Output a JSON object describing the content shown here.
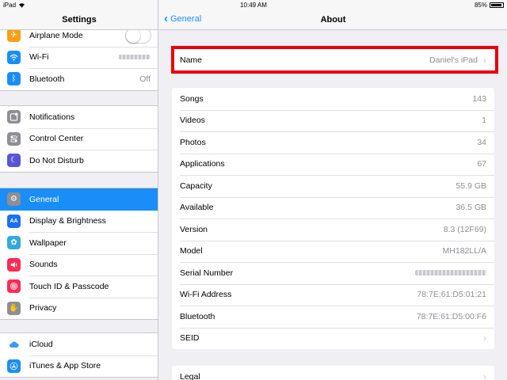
{
  "status_bar": {
    "device": "iPad",
    "time": "10:49 AM",
    "battery": "85%",
    "battery_level": 0.85
  },
  "master": {
    "title": "Settings",
    "groups": [
      [
        {
          "label": "Airplane Mode",
          "icon": "airplane-icon",
          "color": "#f7a113"
        },
        {
          "label": "Wi-Fi",
          "icon": "wifi-icon",
          "color": "#1a8ef8"
        },
        {
          "label": "Bluetooth",
          "icon": "bluetooth-icon",
          "color": "#1a8ef8",
          "value": "Off"
        }
      ],
      [
        {
          "label": "Notifications",
          "icon": "notifications-icon",
          "color": "#8e8e93"
        },
        {
          "label": "Control Center",
          "icon": "control-center-icon",
          "color": "#8e8e93"
        },
        {
          "label": "Do Not Disturb",
          "icon": "moon-icon",
          "color": "#5856d6"
        }
      ],
      [
        {
          "label": "General",
          "icon": "gear-icon",
          "color": "#8e8e93"
        },
        {
          "label": "Display & Brightness",
          "icon": "display-icon",
          "color": "#1a6ff5"
        },
        {
          "label": "Wallpaper",
          "icon": "wallpaper-icon",
          "color": "#34aadc"
        },
        {
          "label": "Sounds",
          "icon": "speaker-icon",
          "color": "#fe2c55"
        },
        {
          "label": "Touch ID & Passcode",
          "icon": "fingerprint-icon",
          "color": "#fe2c55"
        },
        {
          "label": "Privacy",
          "icon": "hand-icon",
          "color": "#8e8e93"
        }
      ],
      [
        {
          "label": "iCloud",
          "icon": "cloud-icon",
          "color": "#ffffff"
        },
        {
          "label": "iTunes & App Store",
          "icon": "app-store-icon",
          "color": "#1a8ef8"
        }
      ]
    ],
    "selected": "General"
  },
  "detail": {
    "back_label": "General",
    "title": "About",
    "name_row": {
      "label": "Name",
      "value": "Daniel's iPad"
    },
    "info_rows": [
      {
        "label": "Songs",
        "value": "143"
      },
      {
        "label": "Videos",
        "value": "1"
      },
      {
        "label": "Photos",
        "value": "34"
      },
      {
        "label": "Applications",
        "value": "67"
      },
      {
        "label": "Capacity",
        "value": "55.9 GB"
      },
      {
        "label": "Available",
        "value": "36.5 GB"
      },
      {
        "label": "Version",
        "value": "8.3 (12F69)"
      },
      {
        "label": "Model",
        "value": "MH182LL/A"
      },
      {
        "label": "Serial Number",
        "value": ""
      },
      {
        "label": "Wi-Fi Address",
        "value": "78:7E:61:D5:01:21"
      },
      {
        "label": "Bluetooth",
        "value": "78:7E:61:D5:00:F6"
      },
      {
        "label": "SEID",
        "value": ""
      }
    ],
    "legal_label": "Legal"
  }
}
